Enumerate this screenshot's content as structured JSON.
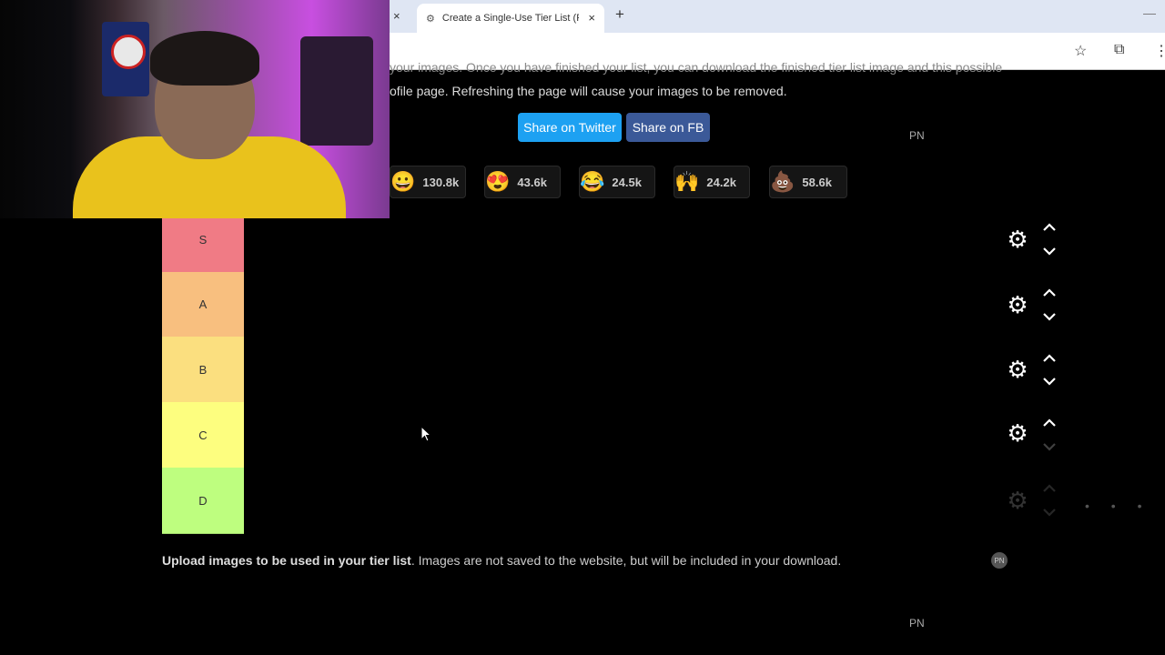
{
  "browser": {
    "tab_title": "Create a Single-Use Tier List (Pi",
    "tab_close": "×",
    "prev_tab_close": "×",
    "new_tab": "+",
    "minimize": "—",
    "toolbar_icons": [
      "star-icon",
      "extensions-icon",
      "menu-icon"
    ]
  },
  "intro": {
    "cut_line": "your images. Once you have finished your list, you can download the finished tier list image and this possible",
    "paragraph": "ofile page. Refreshing the page will cause your images to be removed."
  },
  "share": {
    "twitter_label": "Share on Twitter",
    "facebook_label": "Share on FB",
    "twitter_color": "#1da1f2",
    "facebook_color": "#3b5998"
  },
  "pn_label": "PN",
  "reactions": [
    {
      "emoji": "😀",
      "count": "130.8k"
    },
    {
      "emoji": "😍",
      "count": "43.6k"
    },
    {
      "emoji": "😂",
      "count": "24.5k"
    },
    {
      "emoji": "🙌",
      "count": "24.2k"
    },
    {
      "emoji": "💩",
      "count": "58.6k"
    }
  ],
  "tiers": [
    {
      "label": "S",
      "color": "#f07b85"
    },
    {
      "label": "A",
      "color": "#f8bf7f"
    },
    {
      "label": "B",
      "color": "#fbdf7f"
    },
    {
      "label": "C",
      "color": "#fdfe7f"
    },
    {
      "label": "D",
      "color": "#befe7f"
    }
  ],
  "upload": {
    "bold": "Upload images to be used in your tier list",
    "rest": ". Images are not saved to the website, but will be included in your download."
  },
  "pn_circle": "PN"
}
